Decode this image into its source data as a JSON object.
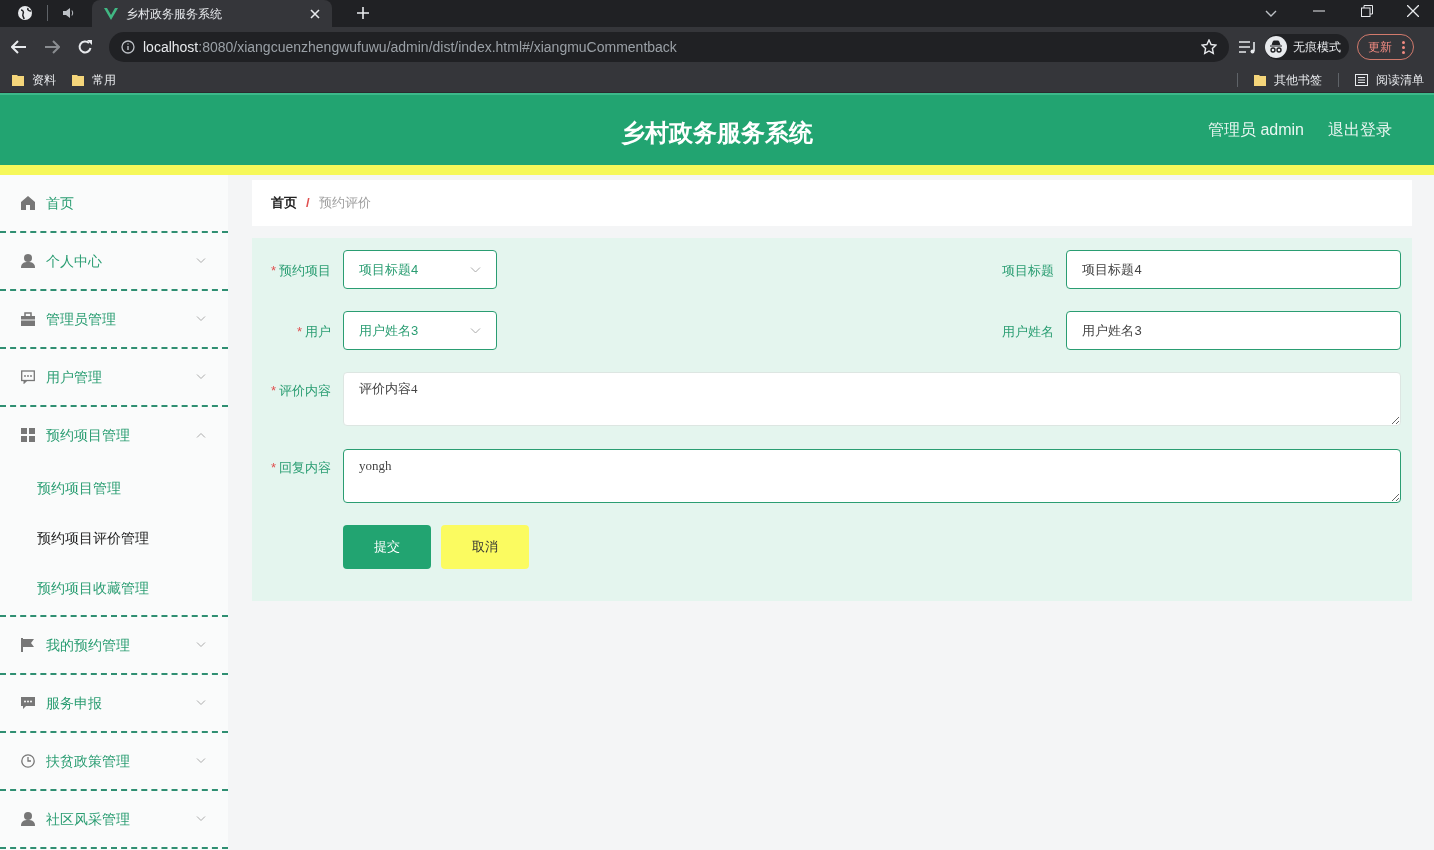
{
  "browser": {
    "tabs": [
      {
        "title": "乡村政务服务系统",
        "selected": true
      }
    ],
    "url_host": "localhost",
    "url_path": ":8080/xiangcuenzhengwufuwu/admin/dist/index.html#/xiangmuCommentback",
    "profile": "无痕模式",
    "update": "更新",
    "bookmarks": [
      "资料",
      "常用"
    ],
    "bookmarks_right": [
      "其他书签",
      "阅读清单"
    ]
  },
  "header": {
    "title": "乡村政务服务系统",
    "user": "管理员 admin",
    "logout": "退出登录"
  },
  "sidebar": {
    "items": [
      {
        "label": "首页"
      },
      {
        "label": "个人中心",
        "expanded": false
      },
      {
        "label": "管理员管理",
        "expanded": false
      },
      {
        "label": "用户管理",
        "expanded": false
      },
      {
        "label": "预约项目管理",
        "expanded": true,
        "children": [
          {
            "label": "预约项目管理",
            "selected": false
          },
          {
            "label": "预约项目评价管理",
            "selected": true
          },
          {
            "label": "预约项目收藏管理",
            "selected": false
          }
        ]
      },
      {
        "label": "我的预约管理",
        "expanded": false
      },
      {
        "label": "服务申报",
        "expanded": false
      },
      {
        "label": "扶贫政策管理",
        "expanded": false
      },
      {
        "label": "社区风采管理",
        "expanded": false
      }
    ]
  },
  "breadcrumb": [
    "首页",
    "预约评价"
  ],
  "breadcrumb_separator": "/",
  "form": {
    "required_mark": "*",
    "rows": [
      [
        {
          "label": "预约项目",
          "required": true,
          "kind": "select",
          "value": "项目标题4"
        },
        {
          "label": "项目标题",
          "required": false,
          "kind": "input",
          "value": "项目标题4"
        }
      ],
      [
        {
          "label": "用户",
          "required": true,
          "kind": "select",
          "value": "用户姓名3"
        },
        {
          "label": "用户姓名",
          "required": false,
          "kind": "input",
          "value": "用户姓名3"
        }
      ],
      [
        {
          "label": "评价内容",
          "required": true,
          "kind": "textarea",
          "value": "评价内容4"
        }
      ],
      [
        {
          "label": "回复内容",
          "required": true,
          "kind": "textarea",
          "value": "yongh"
        }
      ]
    ],
    "buttons": [
      {
        "label": "提交",
        "kind": "primary"
      },
      {
        "label": "取消",
        "kind": "cancel"
      }
    ]
  }
}
